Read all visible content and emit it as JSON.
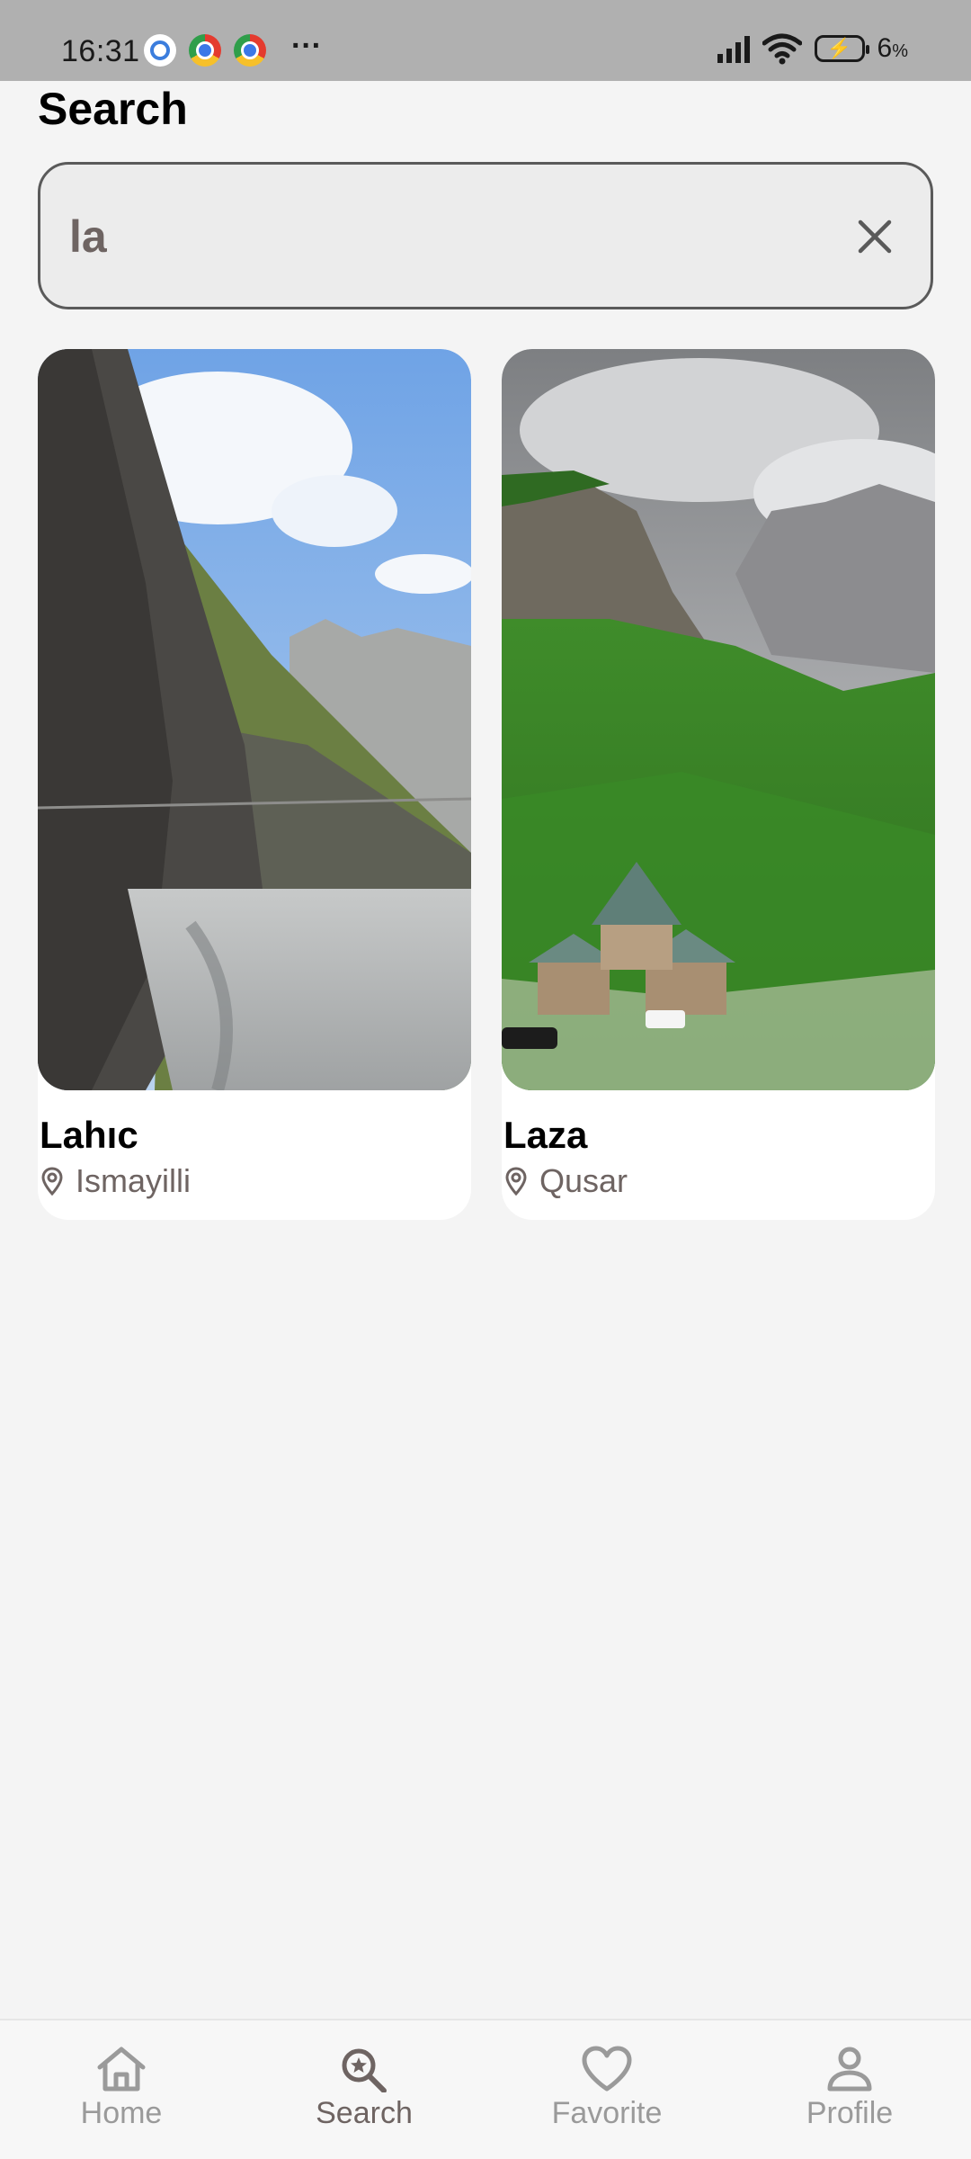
{
  "status_bar": {
    "time": "16:31",
    "battery_percent": "6",
    "battery_unit": "%",
    "more": "···"
  },
  "page": {
    "title": "Search"
  },
  "search": {
    "value": "la"
  },
  "results": [
    {
      "name": "Lahıc",
      "location": "Ismayilli"
    },
    {
      "name": "Laza",
      "location": "Qusar"
    }
  ],
  "nav": [
    {
      "label": "Home"
    },
    {
      "label": "Search"
    },
    {
      "label": "Favorite"
    },
    {
      "label": "Profile"
    }
  ],
  "colors": {
    "accent": "#6e6462",
    "inactive": "#9a9a9a",
    "background": "#f4f4f4"
  }
}
